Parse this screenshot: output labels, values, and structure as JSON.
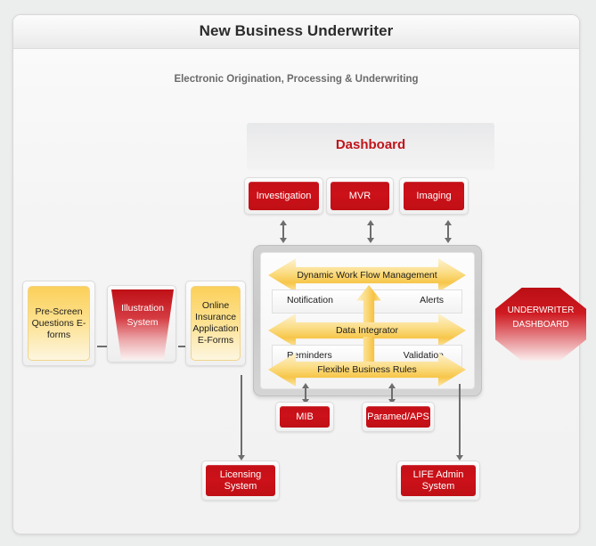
{
  "header": {
    "title": "New Business Underwriter",
    "subtitle": "Electronic Origination, Processing & Underwriting"
  },
  "dashboard_panel": {
    "label": "Dashboard"
  },
  "colors": {
    "red": "#c41018",
    "yellow": "#f7c64a",
    "accent_text": "#c0151b",
    "connector": "#6e6e6e"
  },
  "top_services": [
    {
      "label": "Investigation"
    },
    {
      "label": "MVR"
    },
    {
      "label": "Imaging"
    }
  ],
  "left_flow": [
    {
      "label": "Pre-Screen Questions E-forms",
      "shape": "rounded-rect",
      "color": "yellow"
    },
    {
      "label": "Illustration System",
      "shape": "trapezoid",
      "color": "red"
    },
    {
      "label": "Online Insurance Application E-Forms",
      "shape": "rounded-rect",
      "color": "yellow"
    }
  ],
  "integrator": {
    "bars": [
      {
        "label": "Dynamic Work Flow Management"
      },
      {
        "label": "Data Integrator"
      },
      {
        "label": "Flexible Business Rules"
      }
    ],
    "rows": [
      {
        "left": "Notification",
        "right": "Alerts",
        "arrow": "up"
      },
      {
        "left": "Reminders",
        "right": "Validation",
        "arrow": "down"
      }
    ]
  },
  "underwriter": {
    "line1": "UNDERWRITER",
    "line2": "DASHBOARD"
  },
  "bottom_services": [
    {
      "label": "MIB"
    },
    {
      "label": "Paramed/APS"
    }
  ],
  "bottom_systems": [
    {
      "label": "Licensing System"
    },
    {
      "label": "LIFE Admin System"
    }
  ]
}
